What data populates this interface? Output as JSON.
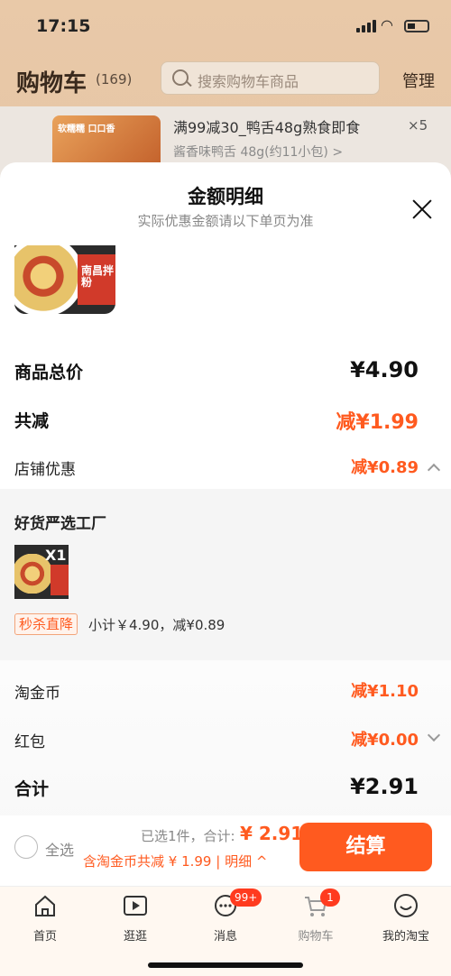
{
  "status": {
    "time": "17:15"
  },
  "cart": {
    "title": "购物车",
    "count": "(169)",
    "search_placeholder": "搜索购物车商品",
    "manage": "管理",
    "item": {
      "thumb_text": "软糯糯 口口香",
      "name": "满99减30_鸭舌48g熟食即食",
      "sku": "酱香味鸭舌 48g(约11小包) >",
      "qty": "×5"
    }
  },
  "sheet": {
    "title": "金额明细",
    "subtitle": "实际优惠金额请以下单页为准",
    "product_box_text": "南昌拌粉",
    "rows": {
      "total_label": "商品总价",
      "total_value": "¥4.90",
      "reduce_label": "共减",
      "reduce_value": "减¥1.99",
      "store_label": "店铺优惠",
      "store_value": "减¥0.89",
      "coin_label": "淘金币",
      "coin_value": "减¥1.10",
      "hongbao_label": "红包",
      "hongbao_value": "减¥0.00",
      "sum_label": "合计",
      "sum_value": "¥2.91"
    },
    "shop": {
      "name": "好货严选工厂",
      "qty_badge": "X1",
      "tag": "秒杀直降",
      "subtotal": "小计￥4.90，减¥0.89"
    }
  },
  "checkout": {
    "select_all": "全选",
    "chosen": "已选1件，合计:",
    "total": "¥ 2.91",
    "coin_note": "含淘金币共减 ¥ 1.99 | 明细 ^",
    "pay": "结算"
  },
  "tabs": [
    {
      "label": "首页",
      "badge": ""
    },
    {
      "label": "逛逛",
      "badge": ""
    },
    {
      "label": "消息",
      "badge": "99+"
    },
    {
      "label": "购物车",
      "badge": "1"
    },
    {
      "label": "我的淘宝",
      "badge": ""
    }
  ],
  "colors": {
    "accent": "#ff5a1f",
    "tabbar_bg": "#fff8f1"
  }
}
